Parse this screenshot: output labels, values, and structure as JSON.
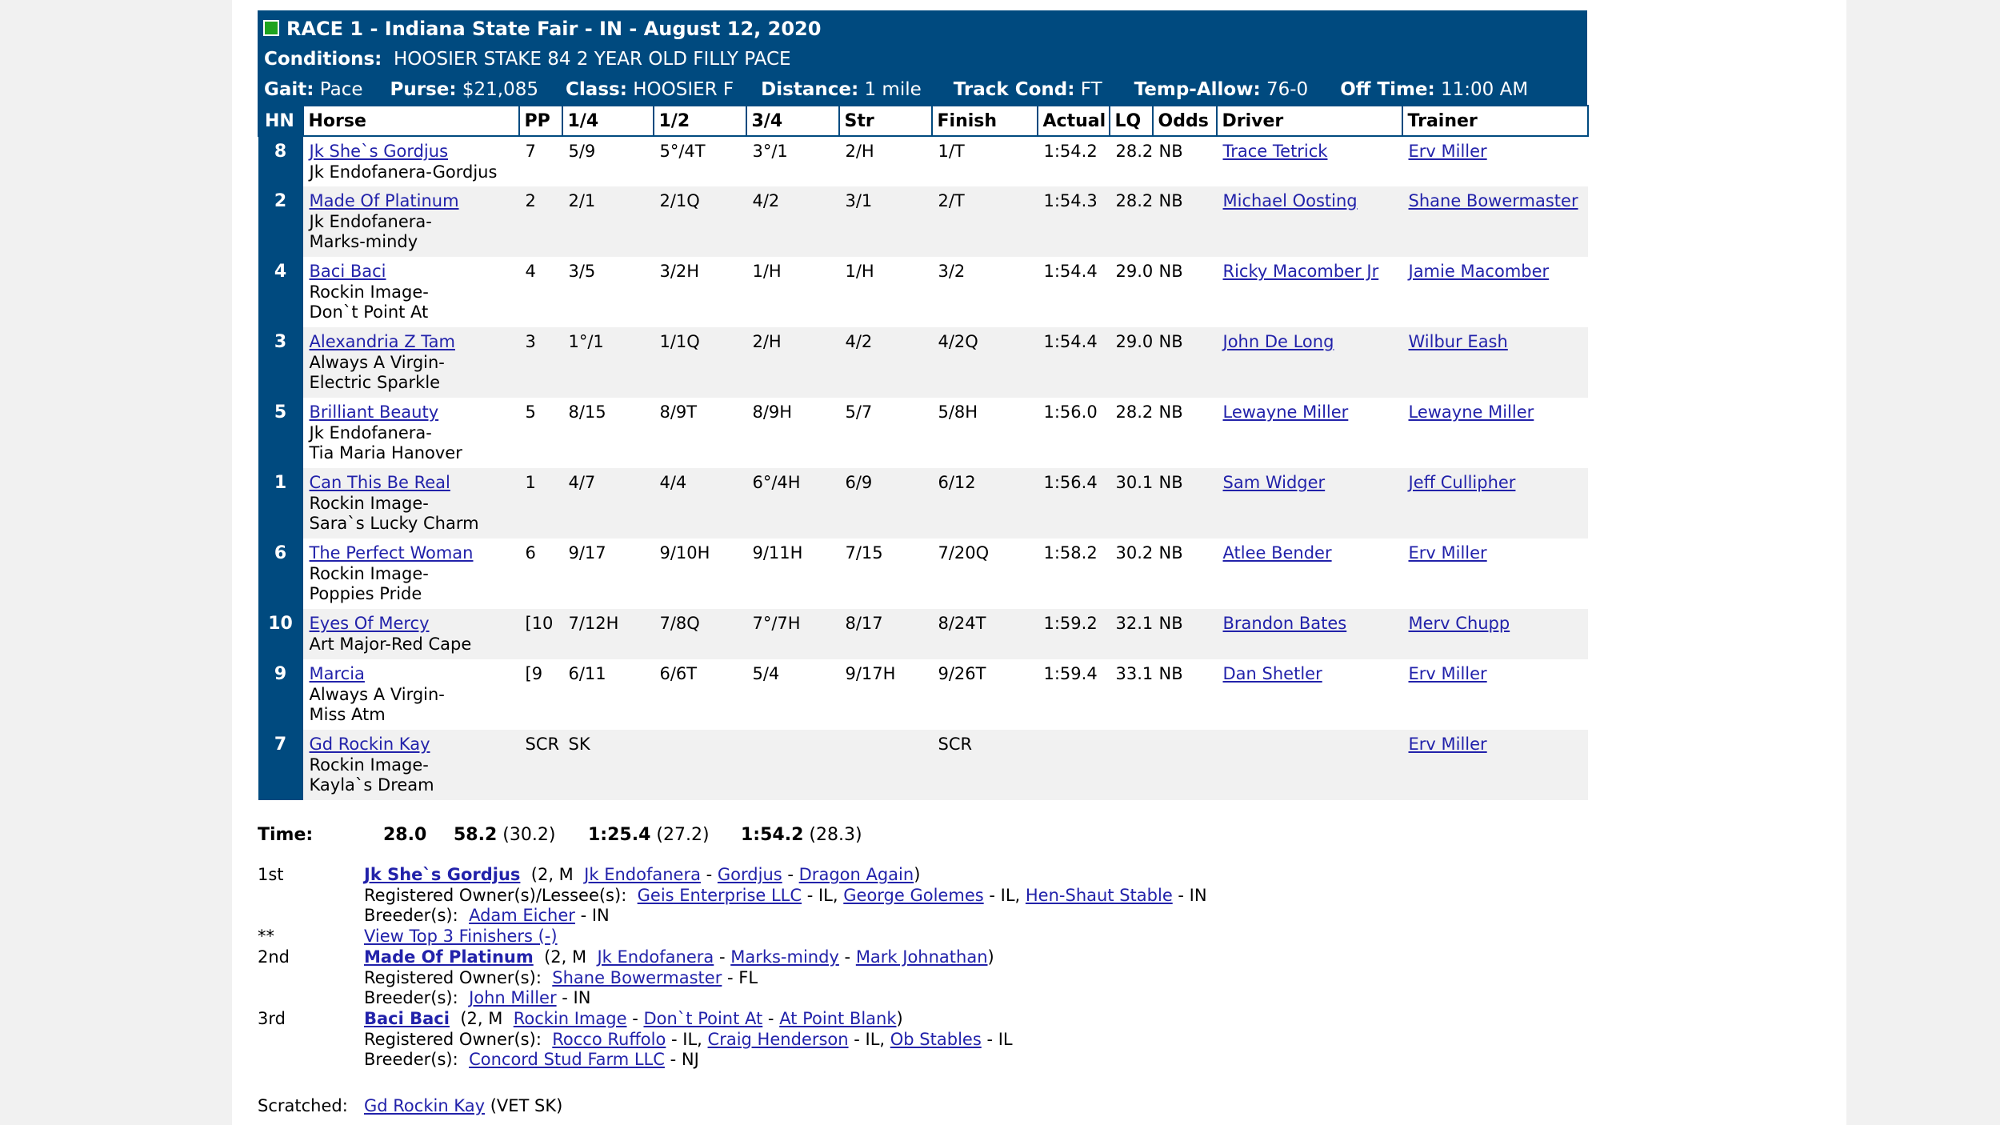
{
  "header": {
    "title": "RACE 1 - Indiana State Fair - IN - August 12, 2020",
    "conditions_label": "Conditions:",
    "conditions": "HOOSIER STAKE 84 2 YEAR OLD FILLY PACE",
    "gait_label": "Gait:",
    "gait": "Pace",
    "purse_label": "Purse:",
    "purse": "$21,085",
    "class_label": "Class:",
    "class": "HOOSIER F",
    "distance_label": "Distance:",
    "distance": "1 mile",
    "track_label": "Track Cond:",
    "track": "FT",
    "temp_label": "Temp-Allow:",
    "temp": "76-0",
    "off_label": "Off Time:",
    "off": "11:00 AM",
    "status_color": "#1ea31e"
  },
  "columns": [
    "HN",
    "Horse",
    "PP",
    "1/4",
    "1/2",
    "3/4",
    "Str",
    "Finish",
    "Actual",
    "LQ",
    "Odds",
    "Driver",
    "Trainer"
  ],
  "rows": [
    {
      "hn": "8",
      "horse": "Jk She`s Gordjus",
      "pedigree": [
        "Jk Endofanera-Gordjus"
      ],
      "pp": "7",
      "q1": "5/9",
      "q2": "5°/4T",
      "q3": "3°/1",
      "str": "2/H",
      "finish": "1/T",
      "actual": "1:54.2",
      "lq": "28.2",
      "odds": "NB",
      "driver": "Trace Tetrick",
      "trainer": "Erv Miller"
    },
    {
      "hn": "2",
      "horse": "Made Of Platinum",
      "pedigree": [
        "Jk Endofanera-",
        "Marks-mindy"
      ],
      "pp": "2",
      "q1": "2/1",
      "q2": "2/1Q",
      "q3": "4/2",
      "str": "3/1",
      "finish": "2/T",
      "actual": "1:54.3",
      "lq": "28.2",
      "odds": "NB",
      "driver": "Michael Oosting",
      "trainer": "Shane Bowermaster"
    },
    {
      "hn": "4",
      "horse": "Baci Baci",
      "pedigree": [
        "Rockin Image-",
        "Don`t Point At"
      ],
      "pp": "4",
      "q1": "3/5",
      "q2": "3/2H",
      "q3": "1/H",
      "str": "1/H",
      "finish": "3/2",
      "actual": "1:54.4",
      "lq": "29.0",
      "odds": "NB",
      "driver": "Ricky Macomber Jr",
      "trainer": "Jamie Macomber"
    },
    {
      "hn": "3",
      "horse": "Alexandria Z Tam",
      "pedigree": [
        "Always A Virgin-",
        "Electric Sparkle"
      ],
      "pp": "3",
      "q1": "1°/1",
      "q2": "1/1Q",
      "q3": "2/H",
      "str": "4/2",
      "finish": "4/2Q",
      "actual": "1:54.4",
      "lq": "29.0",
      "odds": "NB",
      "driver": "John De Long",
      "trainer": "Wilbur Eash"
    },
    {
      "hn": "5",
      "horse": "Brilliant Beauty",
      "pedigree": [
        "Jk Endofanera-",
        "Tia Maria Hanover"
      ],
      "pp": "5",
      "q1": "8/15",
      "q2": "8/9T",
      "q3": "8/9H",
      "str": "5/7",
      "finish": "5/8H",
      "actual": "1:56.0",
      "lq": "28.2",
      "odds": "NB",
      "driver": "Lewayne Miller",
      "trainer": "Lewayne Miller"
    },
    {
      "hn": "1",
      "horse": "Can This Be Real",
      "pedigree": [
        "Rockin Image-",
        "Sara`s Lucky Charm"
      ],
      "pp": "1",
      "q1": "4/7",
      "q2": "4/4",
      "q3": "6°/4H",
      "str": "6/9",
      "finish": "6/12",
      "actual": "1:56.4",
      "lq": "30.1",
      "odds": "NB",
      "driver": "Sam Widger",
      "trainer": "Jeff Cullipher"
    },
    {
      "hn": "6",
      "horse": "The Perfect Woman",
      "pedigree": [
        "Rockin Image-",
        "Poppies Pride"
      ],
      "pp": "6",
      "q1": "9/17",
      "q2": "9/10H",
      "q3": "9/11H",
      "str": "7/15",
      "finish": "7/20Q",
      "actual": "1:58.2",
      "lq": "30.2",
      "odds": "NB",
      "driver": "Atlee Bender",
      "trainer": "Erv Miller"
    },
    {
      "hn": "10",
      "horse": "Eyes Of Mercy",
      "pedigree": [
        "Art Major-Red Cape"
      ],
      "pp": "[10",
      "q1": "7/12H",
      "q2": "7/8Q",
      "q3": "7°/7H",
      "str": "8/17",
      "finish": "8/24T",
      "actual": "1:59.2",
      "lq": "32.1",
      "odds": "NB",
      "driver": "Brandon Bates",
      "trainer": "Merv Chupp"
    },
    {
      "hn": "9",
      "horse": "Marcia",
      "pedigree": [
        "Always A Virgin-",
        "Miss Atm"
      ],
      "pp": "[9",
      "q1": "6/11",
      "q2": "6/6T",
      "q3": "5/4",
      "str": "9/17H",
      "finish": "9/26T",
      "actual": "1:59.4",
      "lq": "33.1",
      "odds": "NB",
      "driver": "Dan Shetler",
      "trainer": "Erv Miller"
    },
    {
      "hn": "7",
      "horse": "Gd Rockin Kay",
      "pedigree": [
        "Rockin Image-",
        "Kayla`s Dream"
      ],
      "pp": "SCR",
      "q1": "SK",
      "q2": "",
      "q3": "",
      "str": "",
      "finish": "SCR",
      "actual": "",
      "lq": "",
      "odds": "",
      "driver": "",
      "trainer": "Erv Miller"
    }
  ],
  "time": {
    "label": "Time:",
    "q1": "28.0",
    "q2": "58.2",
    "q2s": "(30.2)",
    "q3": "1:25.4",
    "q3s": "(27.2)",
    "fin": "1:54.2",
    "fins": "(28.3)"
  },
  "finishers": {
    "first": {
      "place": "1st",
      "horse": "Jk She`s Gordjus",
      "info": "(2, M",
      "sire": "Jk Endofanera",
      "dam": "Gordjus",
      "damsire": "Dragon Again",
      "owners_label": "Registered Owner(s)/Lessee(s):",
      "owner1": "Geis Enterprise LLC",
      "owner1_st": "- IL,",
      "owner2": "George Golemes",
      "owner2_st": "- IL,",
      "owner3": "Hen-Shaut Stable",
      "owner3_st": "- IN",
      "breeder_label": "Breeder(s):",
      "breeder": "Adam Eicher",
      "breeder_st": "- IN"
    },
    "toggle": {
      "mark": "**",
      "label": "View Top 3 Finishers (-)"
    },
    "second": {
      "place": "2nd",
      "horse": "Made Of Platinum",
      "info": "(2, M",
      "sire": "Jk Endofanera",
      "dam": "Marks-mindy",
      "damsire": "Mark Johnathan",
      "owners_label": "Registered Owner(s):",
      "owner1": "Shane Bowermaster",
      "owner1_st": "- FL",
      "breeder_label": "Breeder(s):",
      "breeder": "John Miller",
      "breeder_st": "- IN"
    },
    "third": {
      "place": "3rd",
      "horse": "Baci Baci",
      "info": "(2, M",
      "sire": "Rockin Image",
      "dam": "Don`t Point At",
      "damsire": "At Point Blank",
      "owners_label": "Registered Owner(s):",
      "owner1": "Rocco Ruffolo",
      "owner1_st": "- IL,",
      "owner2": "Craig Henderson",
      "owner2_st": "- IL,",
      "owner3": "Ob Stables",
      "owner3_st": "- IL",
      "breeder_label": "Breeder(s):",
      "breeder": "Concord Stud Farm LLC",
      "breeder_st": "- NJ"
    }
  },
  "scratched": {
    "label": "Scratched:",
    "horse": "Gd Rockin Kay",
    "reason": "(VET SK)"
  }
}
